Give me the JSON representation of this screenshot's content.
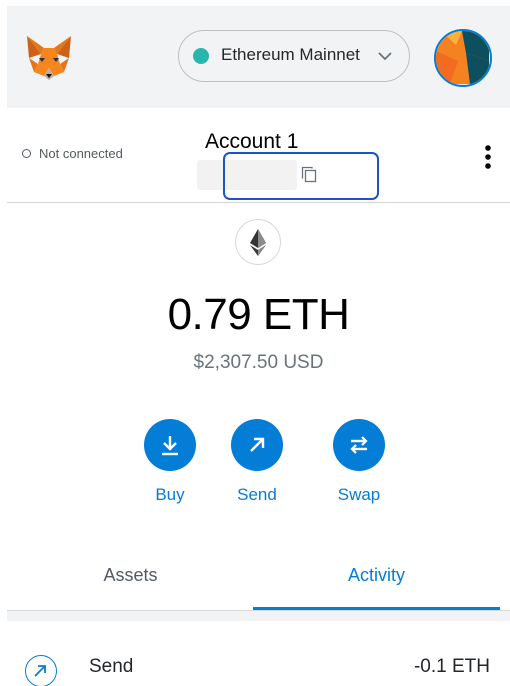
{
  "header": {
    "network": "Ethereum Mainnet"
  },
  "account": {
    "connection_status": "Not connected",
    "name": "Account 1"
  },
  "balance": {
    "primary": "0.79 ETH",
    "fiat": "$2,307.50 USD"
  },
  "actions": [
    {
      "label": "Buy",
      "icon": "download-icon"
    },
    {
      "label": "Send",
      "icon": "arrow-up-right-icon"
    },
    {
      "label": "Swap",
      "icon": "swap-arrows-icon"
    }
  ],
  "tabs": {
    "assets": "Assets",
    "activity": "Activity",
    "selected": "activity"
  },
  "activity": [
    {
      "type": "Send",
      "amount": "-0.1 ETH",
      "icon": "arrow-up-right-icon"
    }
  ],
  "colors": {
    "accent": "#037dd6",
    "network_dot": "#29b6af",
    "highlight_box": "#1d54c4"
  }
}
